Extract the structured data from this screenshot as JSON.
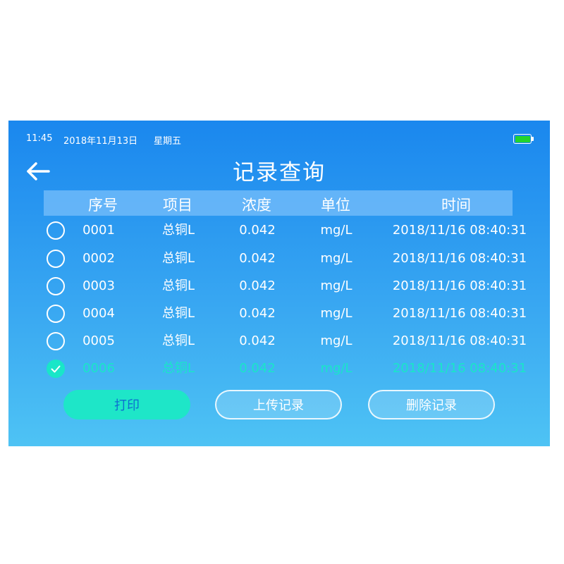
{
  "status": {
    "time": "11:45",
    "date": "2018年11月13日",
    "weekday": "星期五",
    "battery_level": 1.0,
    "battery_color": "#22d42c"
  },
  "header": {
    "title": "记录查询",
    "back_icon": "arrow-left-icon"
  },
  "table": {
    "columns": [
      "序号",
      "项目",
      "浓度",
      "单位",
      "时间"
    ],
    "rows": [
      {
        "id": "0001",
        "item": "总铜L",
        "concentration": "0.042",
        "unit": "mg/L",
        "time": "2018/11/16 08:40:31",
        "selected": false
      },
      {
        "id": "0002",
        "item": "总铜L",
        "concentration": "0.042",
        "unit": "mg/L",
        "time": "2018/11/16 08:40:31",
        "selected": false
      },
      {
        "id": "0003",
        "item": "总铜L",
        "concentration": "0.042",
        "unit": "mg/L",
        "time": "2018/11/16 08:40:31",
        "selected": false
      },
      {
        "id": "0004",
        "item": "总铜L",
        "concentration": "0.042",
        "unit": "mg/L",
        "time": "2018/11/16 08:40:31",
        "selected": false
      },
      {
        "id": "0005",
        "item": "总铜L",
        "concentration": "0.042",
        "unit": "mg/L",
        "time": "2018/11/16 08:40:31",
        "selected": false
      },
      {
        "id": "0006",
        "item": "总铜L",
        "concentration": "0.042",
        "unit": "mg/L",
        "time": "2018/11/16 08:40:31",
        "selected": true
      }
    ]
  },
  "actions": {
    "print_label": "打印",
    "upload_label": "上传记录",
    "delete_label": "删除记录"
  },
  "colors": {
    "accent": "#19e6c8",
    "background_top": "#1a87ee",
    "background_bottom": "#4ec3f4"
  }
}
